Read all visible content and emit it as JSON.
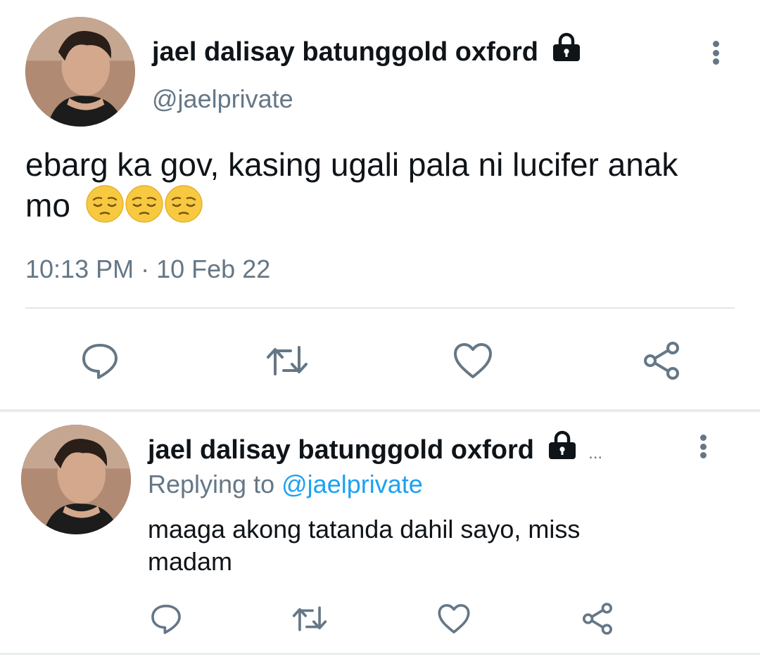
{
  "tweet": {
    "author_name": "jael dalisay batunggold oxford",
    "handle": "@jaelprivate",
    "text": "ebarg ka gov, kasing ugali pala ni lucifer anak mo",
    "text_line1": "ebarg ka gov, kasing ugali pala ni lucifer anak",
    "text_line2": "mo",
    "emojis": [
      "pensive-face-emoji",
      "pensive-face-emoji",
      "pensive-face-emoji"
    ],
    "time": "10:13 PM",
    "date_separator": "·",
    "date": "10 Feb 22",
    "lock_icon": "lock-icon",
    "more_icon": "vertical-ellipsis-icon"
  },
  "actions": {
    "icons": [
      "reply-icon",
      "retweet-icon",
      "like-icon",
      "share-icon"
    ]
  },
  "reply": {
    "author_name": "jael dalisay batunggold oxford",
    "overflow": "...",
    "replying_label": "Replying to",
    "replying_to": "@jaelprivate",
    "text_line1": "maaga akong tatanda dahil sayo, miss",
    "text_line2": "madam"
  },
  "colors": {
    "text": "#0f1419",
    "secondary": "#657786",
    "accent": "#1da1f2",
    "divider": "#e1e8ed"
  }
}
